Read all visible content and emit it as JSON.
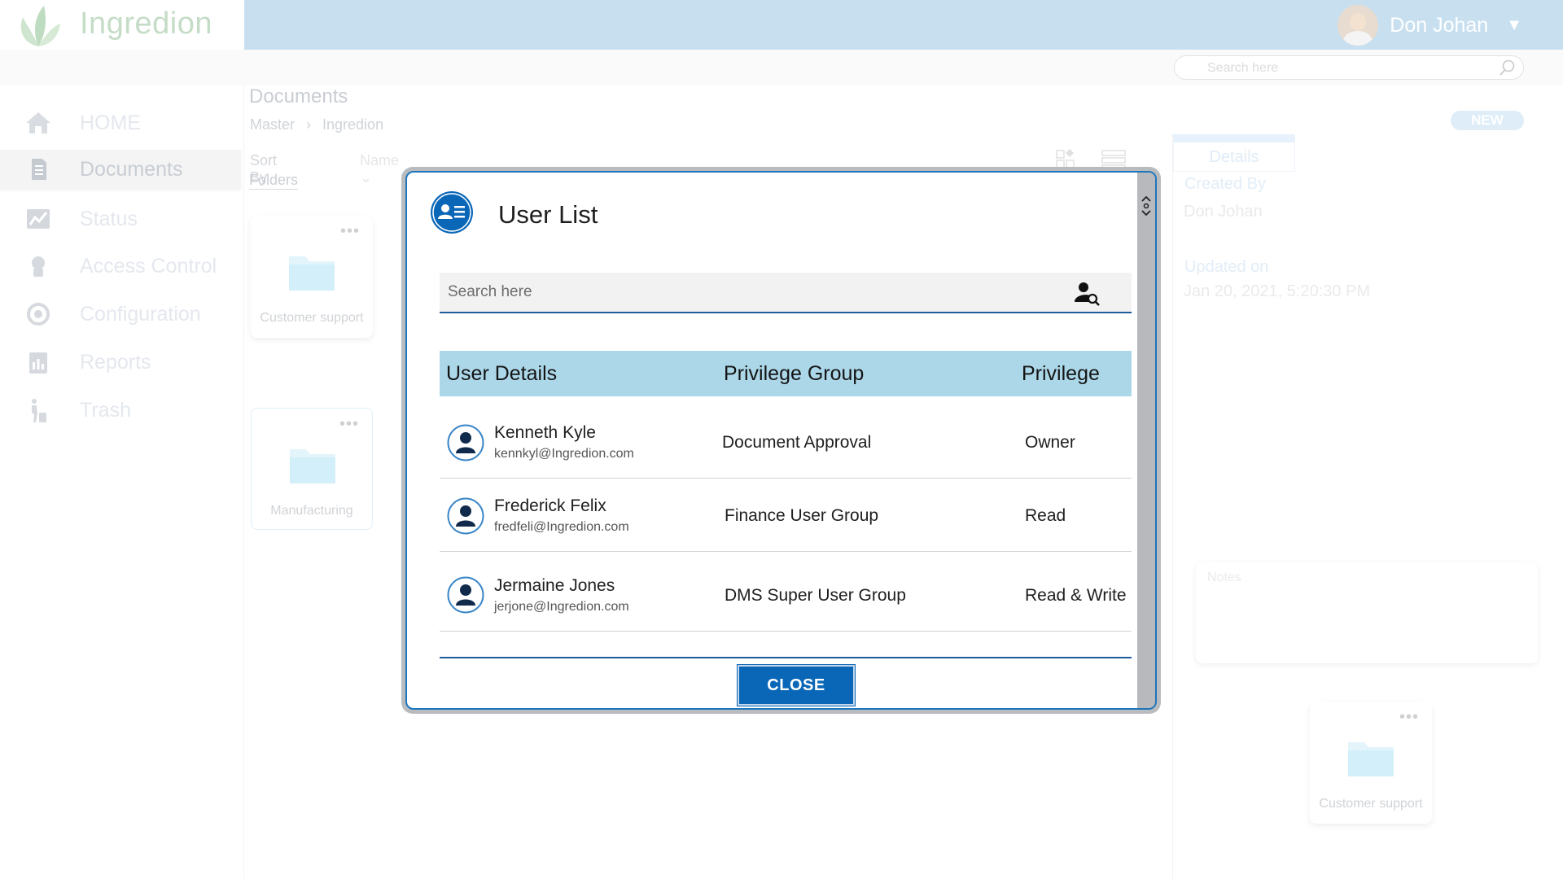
{
  "app": {
    "brand_name": "Ingredion",
    "user_name": "Don Johan",
    "caret": "▼",
    "search": {
      "placeholder": "Search here"
    }
  },
  "sidebar": {
    "items": [
      {
        "label": "HOME",
        "icon": "home-icon"
      },
      {
        "label": "Documents",
        "icon": "document-icon",
        "active": true
      },
      {
        "label": "Status",
        "icon": "status-chart-icon"
      },
      {
        "label": "Access Control",
        "icon": "access-control-icon"
      },
      {
        "label": "Configuration",
        "icon": "configuration-icon"
      },
      {
        "label": "Reports",
        "icon": "reports-icon"
      },
      {
        "label": "Trash",
        "icon": "trash-icon"
      }
    ]
  },
  "main": {
    "title": "Documents",
    "breadcrumb": [
      "Master",
      "›",
      "Ingredion"
    ],
    "sort_by_label": "Sort By",
    "sort_value": "Name  ⌄",
    "folders_label": "Folders",
    "folders": [
      {
        "name": "Customer support",
        "menu": "•••"
      },
      {
        "name": "Manufacturing",
        "menu": "•••"
      }
    ],
    "new_button": "NEW"
  },
  "details": {
    "tab": "Details",
    "created_by_label": "Created By",
    "created_by_value": "Don Johan",
    "updated_on_label": "Updated on",
    "updated_on_value": "Jan 20, 2021, 5:20:30 PM",
    "notes_label": "Notes",
    "folder": {
      "name": "Customer support",
      "menu": "•••"
    }
  },
  "modal": {
    "title": "User List",
    "search_placeholder": "Search here",
    "columns": [
      "User Details",
      "Privilege Group",
      "Privilege"
    ],
    "rows": [
      {
        "name": "Kenneth Kyle",
        "email": "kennkyl@Ingredion.com",
        "group": "Document Approval",
        "privilege": "Owner"
      },
      {
        "name": "Frederick Felix",
        "email": "fredfeli@Ingredion.com",
        "group": "Finance User Group",
        "privilege": "Read"
      },
      {
        "name": "Jermaine  Jones",
        "email": "jerjone@Ingredion.com",
        "group": "DMS Super User Group",
        "privilege": "Read & Write"
      }
    ],
    "close_label": "CLOSE"
  },
  "colors": {
    "accent": "#0a67b8",
    "modal_border": "#1d75bb",
    "table_header": "#acd7e9",
    "topbar": "#c8dff0"
  }
}
